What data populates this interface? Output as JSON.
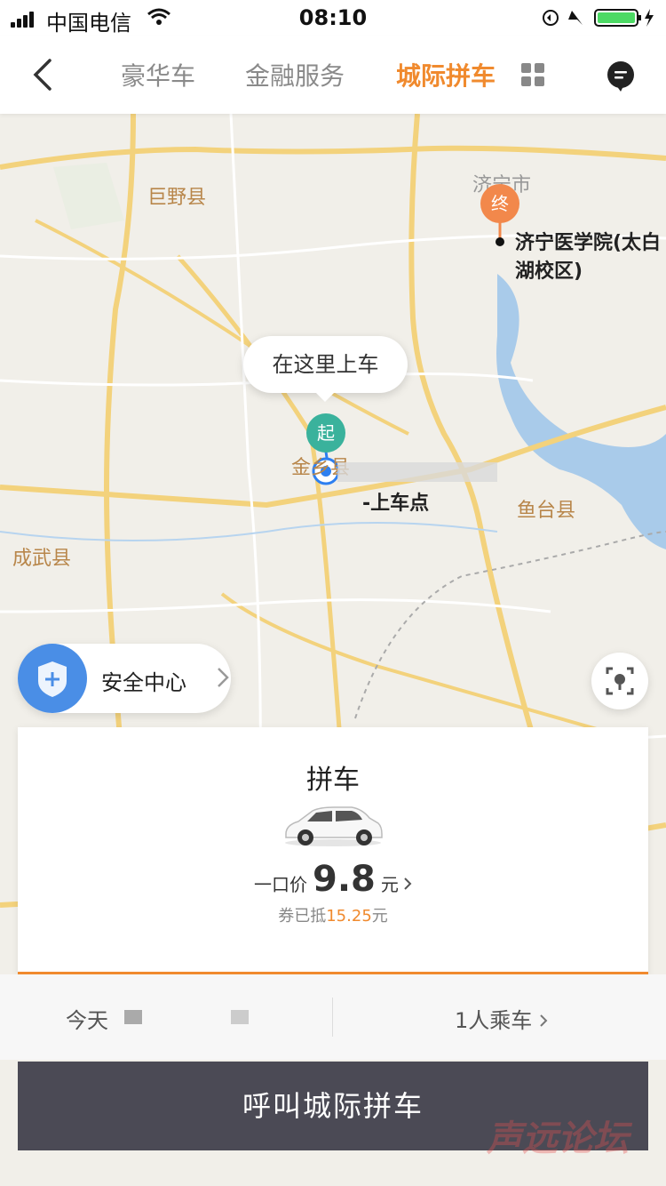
{
  "status_bar": {
    "carrier": "中国电信",
    "time": "08:10"
  },
  "nav": {
    "tabs": [
      {
        "label": "豪华车",
        "active": false
      },
      {
        "label": "金融服务",
        "active": false
      },
      {
        "label": "城际拼车",
        "active": true
      }
    ],
    "accent_color": "#f08a2e"
  },
  "map": {
    "places": [
      {
        "label": "巨野县"
      },
      {
        "label": "济宁市"
      },
      {
        "label": "鱼台县"
      },
      {
        "label": "成武县"
      },
      {
        "label": "金乡县"
      }
    ],
    "pickup_callout": "在这里上车",
    "start_marker": "起",
    "end_marker": "终",
    "destination": "济宁医学院(太白湖校区)",
    "pickup_label": "-上车点"
  },
  "safety": {
    "label": "安全中心"
  },
  "ride_card": {
    "title": "拼车",
    "price_label": "一口价",
    "price": "9.8",
    "price_unit": "元",
    "coupon_prefix": "券已抵",
    "coupon_value": "15.25",
    "coupon_unit": "元"
  },
  "options": {
    "date": "今天",
    "passengers": "1人乘车"
  },
  "call_button": "呼叫城际拼车",
  "watermark": "声远论坛"
}
